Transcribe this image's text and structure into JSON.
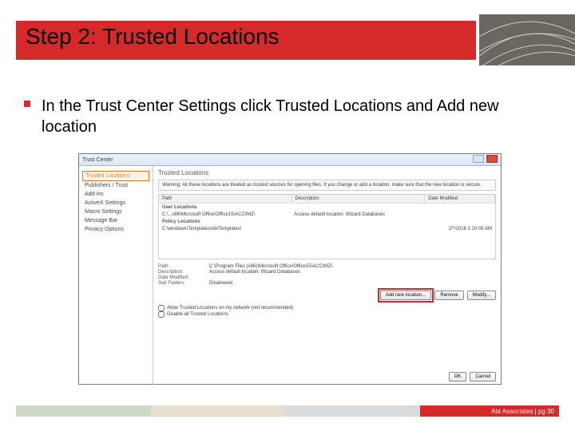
{
  "title": "Step 2: Trusted Locations",
  "bullet": "In the Trust Center Settings click Trusted Locations and Add new location",
  "dialog": {
    "window_title": "Trust Center",
    "section_heading": "Trusted Locations",
    "sidebar": [
      "Trusted Locations",
      "Publishers / Trust",
      "Add-ins",
      "ActiveX Settings",
      "Macro Settings",
      "Message Bar",
      "Privacy Options"
    ],
    "warning": "Warning: All these locations are treated as trusted sources for opening files. If you change or add a location, make sure that the new location is secure.",
    "columns": {
      "c1": "Path",
      "c2": "Description",
      "c3": "Date Modified"
    },
    "user_header": "User Locations",
    "row1": {
      "path": "C:\\...x86\\Microsoft Office\\Office15\\ACCWIZ\\",
      "desc": "Access default location: Wizard Databases",
      "date": ""
    },
    "policy_header": "Policy Locations",
    "row2": {
      "path": "C:\\windows\\Templates\\AbtTemplates\\",
      "desc": "",
      "date": "2/*/2016 1:20:08 AM"
    },
    "details": {
      "path_lbl": "Path:",
      "path_val": "C:\\Program Files (x86)\\Microsoft Office\\Office15\\ACCWIZ\\",
      "desc_lbl": "Description:",
      "desc_val": "Access default location: Wizard Databases",
      "date_lbl": "Date Modified:",
      "date_val": "",
      "sub_lbl": "Sub Folders:",
      "sub_val": "Disallowed"
    },
    "buttons": {
      "add": "Add new location...",
      "remove": "Remove",
      "modify": "Modify..."
    },
    "check1": "Allow Trusted Locations on my network (not recommended)",
    "check2": "Disable all Trusted Locations",
    "ok": "OK",
    "cancel": "Cancel"
  },
  "footer": "Abt Associates | pg 30"
}
